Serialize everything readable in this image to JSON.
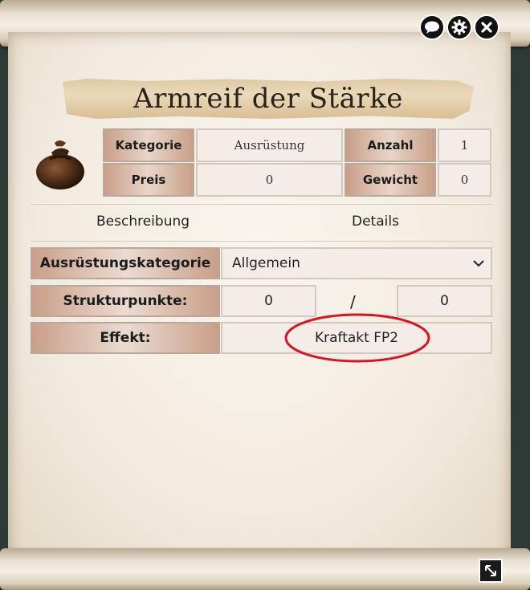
{
  "title": "Armreif der Stärke",
  "info": {
    "kategorie_label": "Kategorie",
    "kategorie_value": "Ausrüstung",
    "anzahl_label": "Anzahl",
    "anzahl_value": "1",
    "preis_label": "Preis",
    "preis_value": "0",
    "gewicht_label": "Gewicht",
    "gewicht_value": "0"
  },
  "tabs": [
    "Beschreibung",
    "Details"
  ],
  "form": {
    "kategorie_label": "Ausrüstungskategorie",
    "kategorie_value": "Allgemein",
    "struktur_label": "Strukturpunkte:",
    "struktur_current": "0",
    "struktur_sep": "/",
    "struktur_max": "0",
    "effekt_label": "Effekt:",
    "effekt_value": "Kraftakt FP2"
  },
  "controls": {
    "chat_icon": "speech-bubble-icon",
    "settings_icon": "gear-icon",
    "close_icon": "close-icon",
    "resize_icon": "resize-arrows-icon"
  },
  "colors": {
    "highlight_ring": "#d9141e",
    "label_bg": "#c99f8a"
  }
}
